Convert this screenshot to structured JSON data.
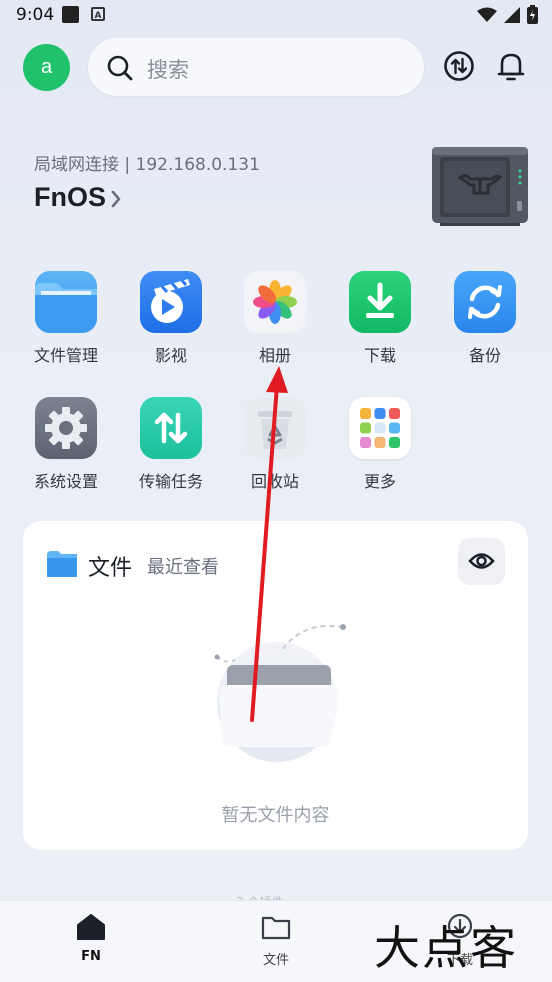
{
  "status_bar": {
    "time": "9:04"
  },
  "header": {
    "avatar_letter": "a",
    "search_placeholder": "搜索"
  },
  "connection": {
    "text": "局域网连接 | 192.168.0.131",
    "device_name": "FnOS"
  },
  "apps": [
    {
      "label": "文件管理",
      "icon": "folder-icon"
    },
    {
      "label": "影视",
      "icon": "film-icon"
    },
    {
      "label": "相册",
      "icon": "photos-icon"
    },
    {
      "label": "下载",
      "icon": "download-icon"
    },
    {
      "label": "备份",
      "icon": "backup-icon"
    },
    {
      "label": "系统设置",
      "icon": "gear-icon"
    },
    {
      "label": "传输任务",
      "icon": "transfer-icon"
    },
    {
      "label": "回收站",
      "icon": "recycle-bin-icon"
    },
    {
      "label": "更多",
      "icon": "more-apps-icon"
    }
  ],
  "recent_card": {
    "title": "文件",
    "subtitle": "最近查看",
    "empty_text": "暂无文件内容"
  },
  "faded_label": "3 个插件",
  "tabs": [
    {
      "label": "FN",
      "active": true
    },
    {
      "label": "文件",
      "active": false
    },
    {
      "label": "下载",
      "active": false
    }
  ],
  "watermark": "大点客",
  "colors": {
    "accent_green": "#1fc26a",
    "annotation_arrow": "#e11b22"
  }
}
